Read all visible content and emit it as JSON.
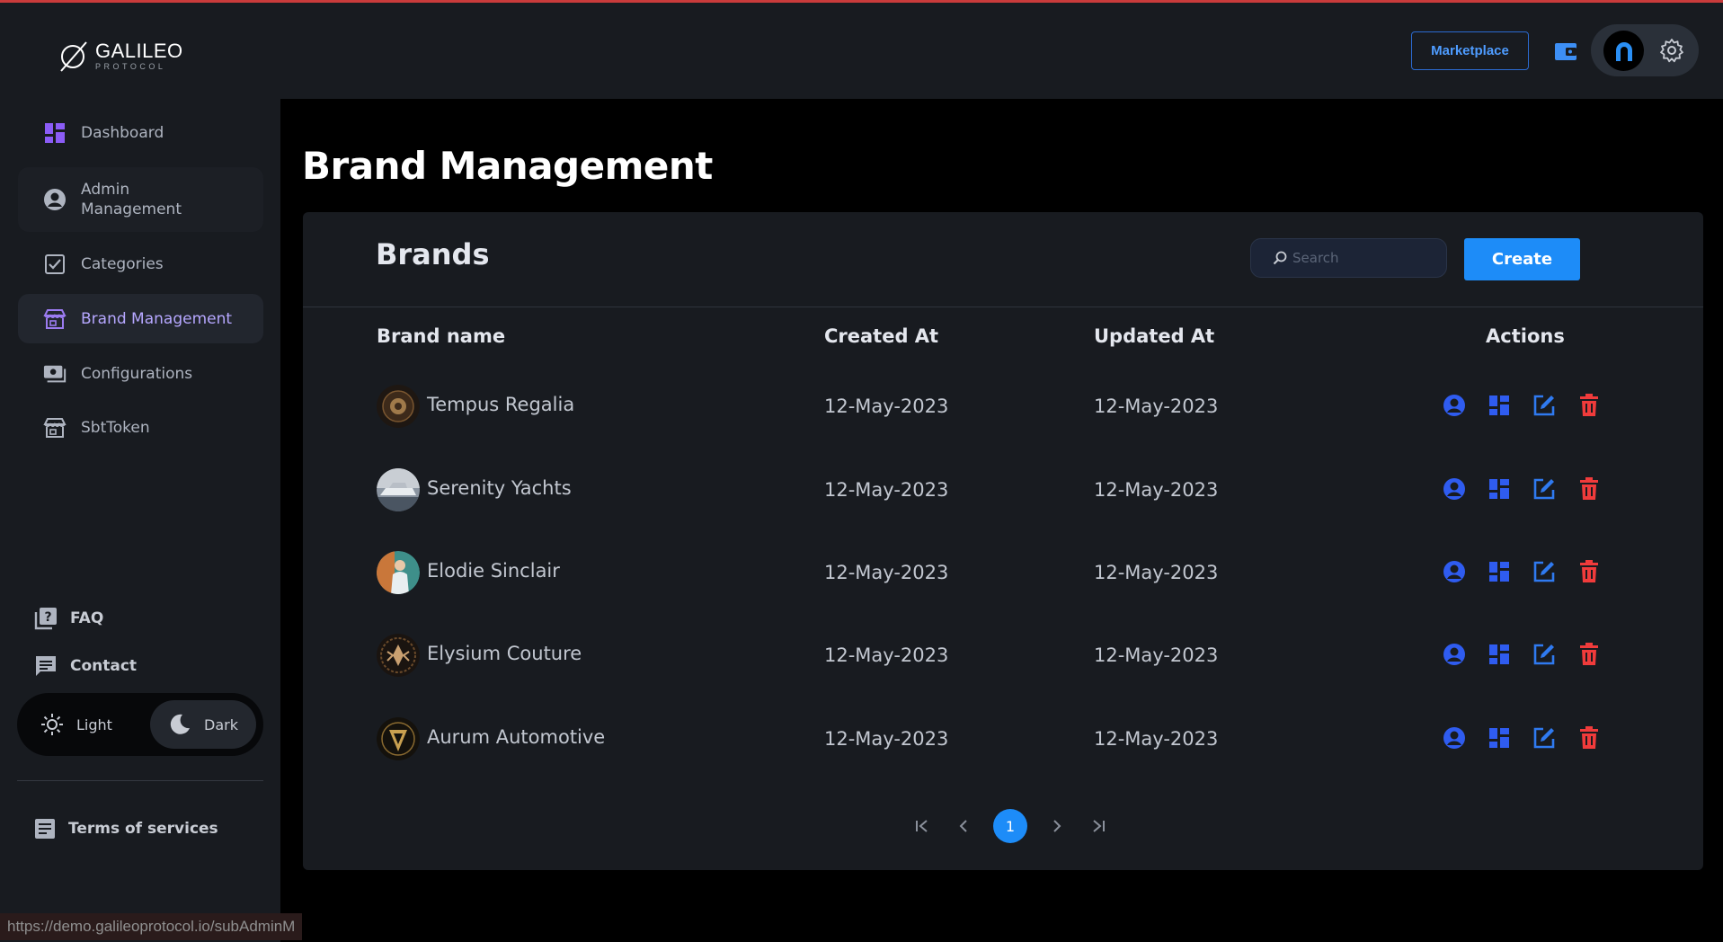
{
  "app": {
    "logo_main": "GALILEO",
    "logo_sub": "PROTOCOL"
  },
  "sidebar": {
    "items": [
      {
        "label": "Dashboard",
        "icon": "dashboard-icon"
      },
      {
        "label": "Admin Management",
        "icon": "account-circle-icon"
      },
      {
        "label": "Categories",
        "icon": "checklist-icon"
      },
      {
        "label": "Brand Management",
        "icon": "store-icon",
        "active": true
      },
      {
        "label": "Configurations",
        "icon": "payments-icon"
      },
      {
        "label": "SbtToken",
        "icon": "store-icon"
      }
    ],
    "faq": "FAQ",
    "contact": "Contact",
    "theme_light": "Light",
    "theme_dark": "Dark",
    "terms": "Terms of services"
  },
  "header": {
    "marketplace_label": "Marketplace",
    "wallet_icon": "wallet-icon",
    "settings_icon": "gear-icon"
  },
  "main": {
    "page_title": "Brand Management",
    "card_title": "Brands",
    "search_placeholder": "Search",
    "create_label": "Create",
    "columns": [
      "Brand name",
      "Created At",
      "Updated At",
      "Actions"
    ],
    "rows": [
      {
        "name": "Tempus Regalia",
        "created": "12-May-2023",
        "updated": "12-May-2023"
      },
      {
        "name": "Serenity Yachts",
        "created": "12-May-2023",
        "updated": "12-May-2023"
      },
      {
        "name": "Elodie Sinclair",
        "created": "12-May-2023",
        "updated": "12-May-2023"
      },
      {
        "name": "Elysium Couture",
        "created": "12-May-2023",
        "updated": "12-May-2023"
      },
      {
        "name": "Aurum Automotive",
        "created": "12-May-2023",
        "updated": "12-May-2023"
      }
    ],
    "pagination": {
      "current_page": "1"
    }
  },
  "colors": {
    "accent": "#1d8cf8",
    "action_blue": "#2f5cf0",
    "delete_red": "#f03b3b",
    "active_nav": "#b6a7ff"
  },
  "statusbar": {
    "url": "https://demo.galileoprotocol.io/subAdminM"
  }
}
